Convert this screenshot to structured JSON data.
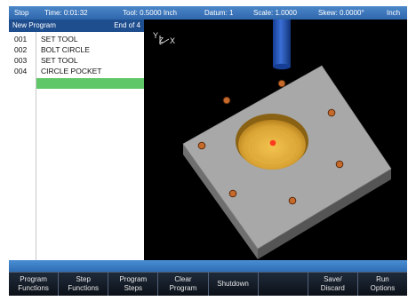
{
  "status": {
    "mode": "Stop",
    "time": "Time: 0:01:32",
    "tool": "Tool: 0.5000 Inch",
    "datum": "Datum: 1",
    "scale": "Scale: 1.0000",
    "skew": "Skew: 0.0000°",
    "units": "Inch"
  },
  "program": {
    "title": "New Program",
    "position": "End of 4",
    "steps": [
      {
        "num": "001",
        "name": "SET TOOL"
      },
      {
        "num": "002",
        "name": "BOLT CIRCLE"
      },
      {
        "num": "003",
        "name": "SET TOOL"
      },
      {
        "num": "004",
        "name": "CIRCLE POCKET"
      }
    ]
  },
  "viewport": {
    "axis_y": "Y",
    "axis_z": "Z",
    "axis_x": "X"
  },
  "softkeys": [
    "Program\nFunctions",
    "Step\nFunctions",
    "Program\nSteps",
    "Clear\nProgram",
    "Shutdown",
    "",
    "Save/\nDiscard",
    "Run\nOptions"
  ],
  "colors": {
    "status_bar": "#3b78bf",
    "highlight_row": "#60c768",
    "plate": "#a9a9a9",
    "pocket": "#d9a73a",
    "tool": "#1f4fb8",
    "hole": "#c56a2a"
  }
}
